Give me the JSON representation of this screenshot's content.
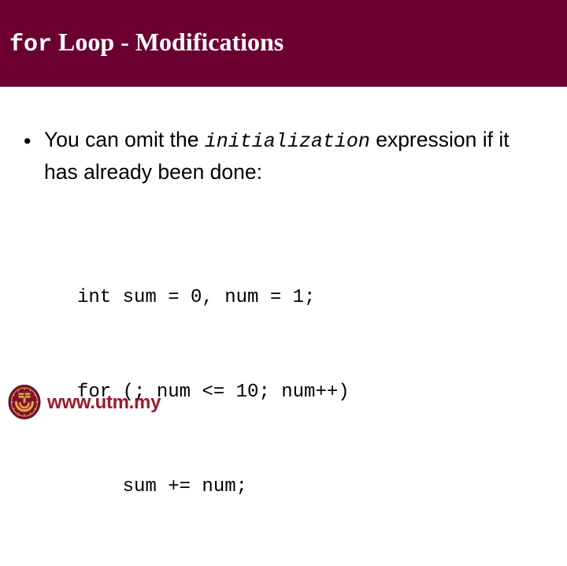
{
  "slide": {
    "title": {
      "mono_part": "for",
      "serif_part": " Loop - Modifications"
    },
    "header_color": "#6B0030",
    "background_color": "#FFFFFF"
  },
  "body": {
    "bullet_marker": "•",
    "bullet": {
      "lead": "You can omit the ",
      "code_term": "initialization",
      "tail": " expression if it has already been done:"
    },
    "code_lines": [
      "int sum = 0, num = 1;",
      "for (; num <= 10; num++)",
      "    sum += num;"
    ]
  },
  "footer": {
    "logo_name": "utm-seal-logo",
    "logo_ring_color": "#7A1433",
    "logo_emblem_color": "#E8A33D",
    "url": "www.utm.my",
    "url_color": "#9C1B2B"
  }
}
